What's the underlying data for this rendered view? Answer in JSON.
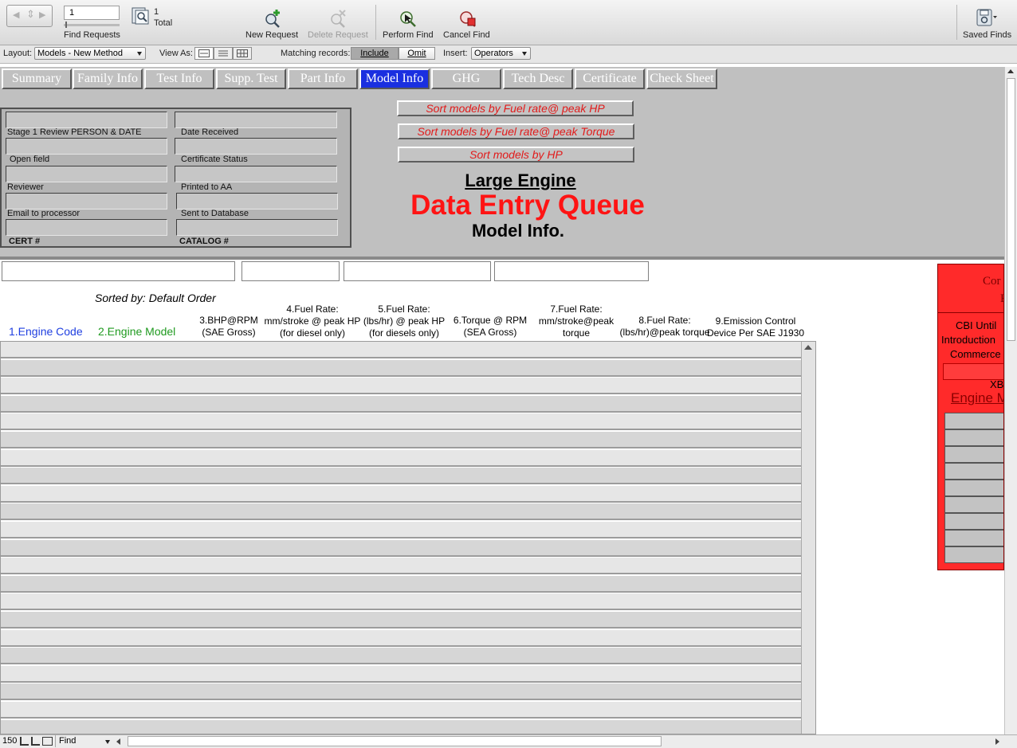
{
  "toolbar": {
    "record_value": "1",
    "records_count": "1",
    "records_total_label": "Total",
    "find_requests_label": "Find Requests",
    "new_request_label": "New Request",
    "delete_request_label": "Delete Request",
    "perform_find_label": "Perform Find",
    "cancel_find_label": "Cancel Find",
    "saved_finds_label": "Saved Finds"
  },
  "layoutbar": {
    "layout_label": "Layout:",
    "layout_value": "Models - New Method",
    "view_as_label": "View As:",
    "matching_label": "Matching records:",
    "include_label": "Include",
    "omit_label": "Omit",
    "insert_label": "Insert:",
    "insert_value": "Operators"
  },
  "tabs": [
    {
      "label": "Summary"
    },
    {
      "label": "Family Info"
    },
    {
      "label": "Test Info"
    },
    {
      "label": "Supp. Test"
    },
    {
      "label": "Part Info"
    },
    {
      "label": "Model Info"
    },
    {
      "label": "GHG"
    },
    {
      "label": "Tech Desc"
    },
    {
      "label": "Certificate"
    },
    {
      "label": "Check Sheet"
    }
  ],
  "panel": {
    "stage1": "Stage 1 Review PERSON & DATE",
    "date_received": "Date  Received",
    "open_field": "Open field",
    "cert_status": "Certificate Status",
    "reviewer": "Reviewer",
    "printed_to_aa": "Printed to AA",
    "email_processor": "Email to processor",
    "sent_to_db": "Sent to Database",
    "cert_num": "CERT #",
    "catalog_num": "CATALOG #"
  },
  "sort_buttons": {
    "fuel_hp": "Sort models by Fuel rate@ peak HP",
    "fuel_torque": "Sort models by Fuel rate@ peak Torque",
    "hp": "Sort models by HP"
  },
  "headings": {
    "line1": "Large Engine",
    "line2": "Data Entry Queue",
    "line3": "Model Info."
  },
  "sorted_by": "Sorted by:  Default Order",
  "columns": {
    "c1": "1.Engine Code",
    "c2": "2.Engine Model",
    "c3a": "3.BHP@RPM",
    "c3b": "(SAE Gross)",
    "c4a": "4.Fuel Rate:",
    "c4b": "mm/stroke @ peak HP",
    "c4c": "(for diesel only)",
    "c5a": "5.Fuel Rate:",
    "c5b": "(lbs/hr) @ peak HP",
    "c5c": "(for diesels only)",
    "c6a": "6.Torque @ RPM",
    "c6b": "(SEA Gross)",
    "c7a": "7.Fuel Rate:",
    "c7b": "mm/stroke@peak",
    "c7c": "torque",
    "c8a": "8.Fuel Rate:",
    "c8b": "(lbs/hr)@peak torque",
    "c9a": "9.Emission Control",
    "c9b": "Device Per SAE J1930"
  },
  "red_panel": {
    "top_frag1": "Cor",
    "top_frag2": "E",
    "cbi1": "CBI Until",
    "cbi2": "Introduction",
    "cbi3": "Commerce",
    "xb": "XB",
    "engine_model": "Engine M"
  },
  "bottombar": {
    "zoom": "150",
    "mode": "Find"
  },
  "colors": {
    "active_tab": "#1a2fe0",
    "title_red": "#ff1414",
    "engine_code_blue": "#1f3fe0",
    "engine_model_green": "#1f9a1f"
  }
}
